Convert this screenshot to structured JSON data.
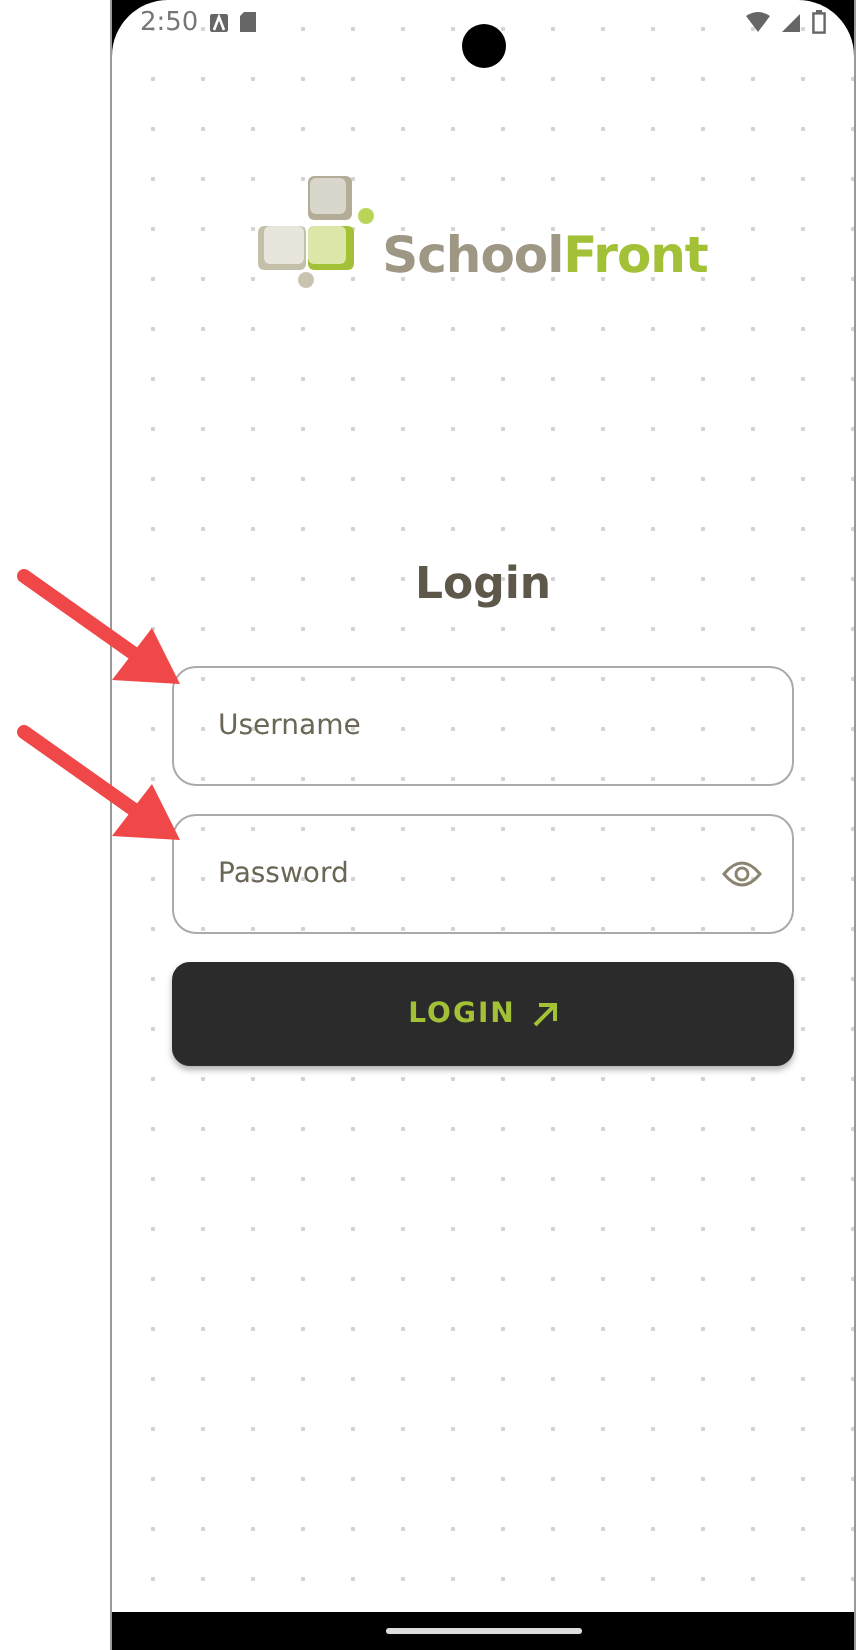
{
  "status_bar": {
    "time": "2:50"
  },
  "logo": {
    "name_part_1": "School",
    "name_part_2": "Front"
  },
  "title": "Login",
  "fields": [
    {
      "kind": "text",
      "placeholder": "Username"
    },
    {
      "kind": "password",
      "placeholder": "Password"
    }
  ],
  "login_button": {
    "label": "LOGIN"
  }
}
